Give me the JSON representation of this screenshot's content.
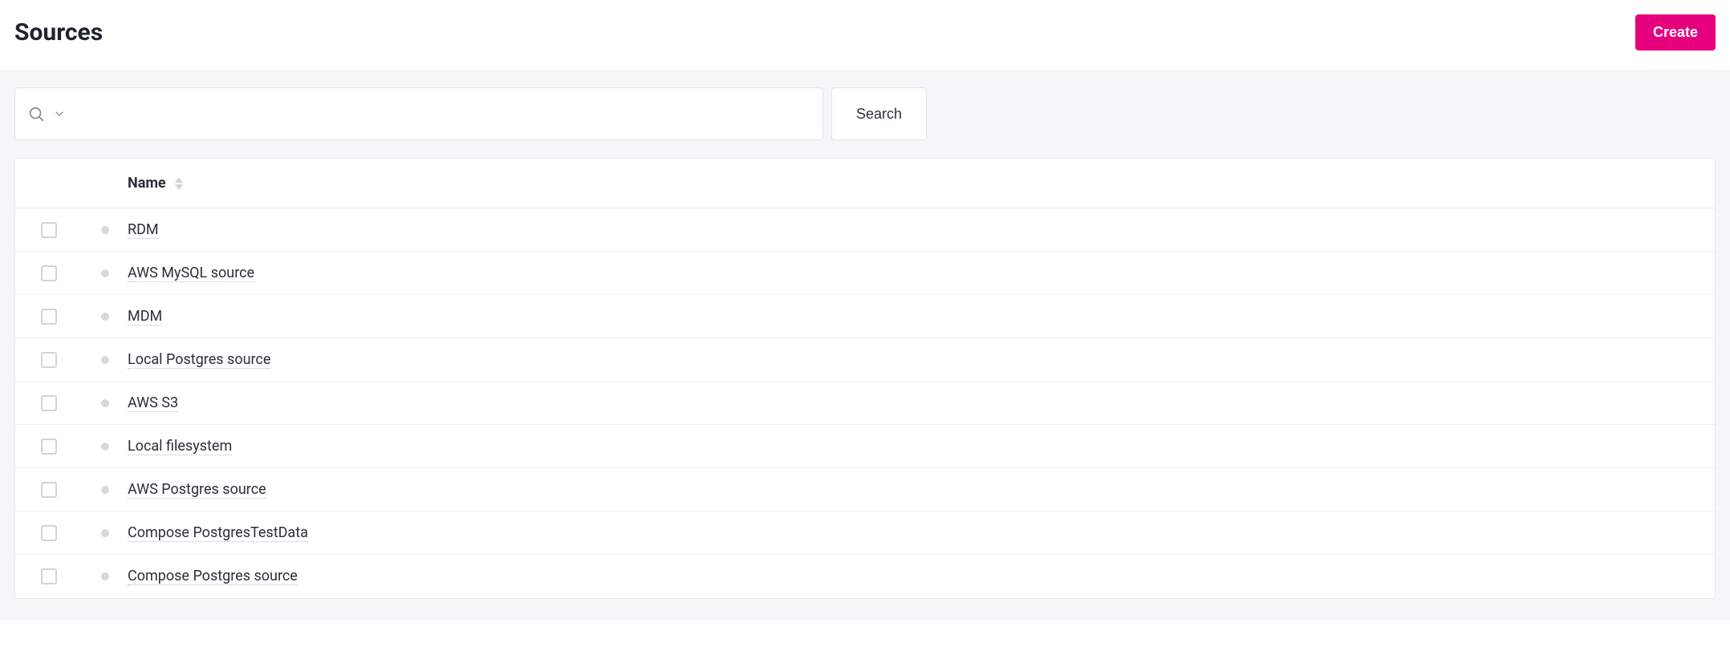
{
  "header": {
    "title": "Sources",
    "create_label": "Create"
  },
  "search": {
    "value": "",
    "button_label": "Search"
  },
  "table": {
    "columns": {
      "name": "Name"
    },
    "rows": [
      {
        "name": "RDM"
      },
      {
        "name": "AWS MySQL source"
      },
      {
        "name": "MDM"
      },
      {
        "name": "Local Postgres source"
      },
      {
        "name": "AWS S3"
      },
      {
        "name": "Local filesystem"
      },
      {
        "name": "AWS Postgres source"
      },
      {
        "name": "Compose PostgresTestData"
      },
      {
        "name": "Compose Postgres source"
      }
    ]
  }
}
